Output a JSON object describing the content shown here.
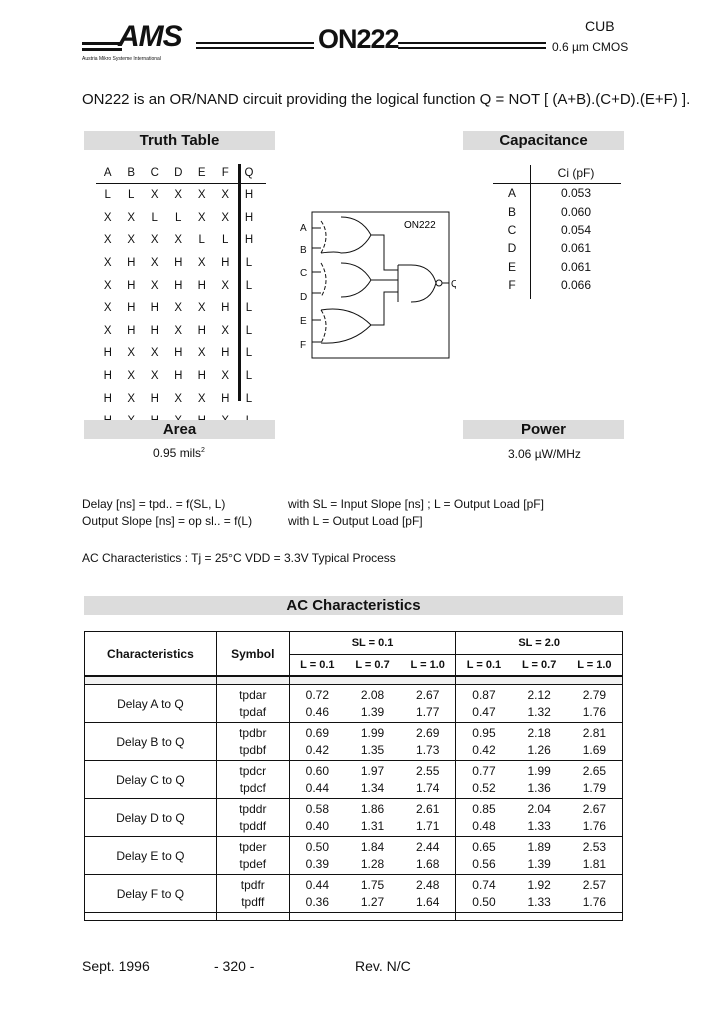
{
  "header": {
    "logo": "AMS",
    "logo_subtitle": "Austria Mikro Systeme International",
    "part": "ON222",
    "process_line1": "CUB",
    "process_line2": "0.6 µm CMOS"
  },
  "description": "ON222 is an OR/NAND circuit providing the logical function Q = NOT [ (A+B).(C+D).(E+F) ].",
  "truth_table": {
    "title": "Truth Table",
    "columns": [
      "A",
      "B",
      "C",
      "D",
      "E",
      "F",
      "Q"
    ],
    "rows": [
      [
        "L",
        "L",
        "X",
        "X",
        "X",
        "X",
        "H"
      ],
      [
        "X",
        "X",
        "L",
        "L",
        "X",
        "X",
        "H"
      ],
      [
        "X",
        "X",
        "X",
        "X",
        "L",
        "L",
        "H"
      ],
      [
        "X",
        "H",
        "X",
        "H",
        "X",
        "H",
        "L"
      ],
      [
        "X",
        "H",
        "X",
        "H",
        "H",
        "X",
        "L"
      ],
      [
        "X",
        "H",
        "H",
        "X",
        "X",
        "H",
        "L"
      ],
      [
        "X",
        "H",
        "H",
        "X",
        "H",
        "X",
        "L"
      ],
      [
        "H",
        "X",
        "X",
        "H",
        "X",
        "H",
        "L"
      ],
      [
        "H",
        "X",
        "X",
        "H",
        "H",
        "X",
        "L"
      ],
      [
        "H",
        "X",
        "H",
        "X",
        "X",
        "H",
        "L"
      ],
      [
        "H",
        "X",
        "H",
        "X",
        "H",
        "X",
        "L"
      ]
    ]
  },
  "schematic": {
    "label": "ON222",
    "inputs": [
      "A",
      "B",
      "C",
      "D",
      "E",
      "F"
    ],
    "output": "Q"
  },
  "capacitance": {
    "title": "Capacitance",
    "header": "Ci (pF)",
    "rows": [
      {
        "pin": "A",
        "value": "0.053"
      },
      {
        "pin": "B",
        "value": "0.060"
      },
      {
        "pin": "C",
        "value": "0.054"
      },
      {
        "pin": "D",
        "value": "0.061"
      },
      {
        "pin": "E",
        "value": "0.061"
      },
      {
        "pin": "F",
        "value": "0.066"
      }
    ]
  },
  "area": {
    "title": "Area",
    "value": "0.95  mils",
    "exp": "2"
  },
  "power": {
    "title": "Power",
    "value": "3.06 µW/MHz"
  },
  "formulas": {
    "delay_left": "Delay [ns]  =  tpd..  =  f(SL, L)",
    "delay_right": "with  SL = Input Slope [ns] ;  L = Output Load [pF]",
    "slope_left": "Output Slope [ns]  =  op  sl..  =  f(L)",
    "slope_right": "with  L = Output Load [pF]",
    "conditions": "AC Characteristics :    Tj = 25°C    VDD = 3.3V    Typical Process"
  },
  "ac": {
    "title": "AC Characteristics",
    "col_char": "Characteristics",
    "col_symbol": "Symbol",
    "groups": [
      "SL = 0.1",
      "SL = 2.0"
    ],
    "loads": [
      "L = 0.1",
      "L = 0.7",
      "L = 1.0",
      "L = 0.1",
      "L = 0.7",
      "L = 1.0"
    ],
    "rows": [
      {
        "name": "Delay A to Q",
        "symbols": [
          "tpdar",
          "tpdaf"
        ],
        "values": [
          [
            "0.72",
            "2.08",
            "2.67",
            "0.87",
            "2.12",
            "2.79"
          ],
          [
            "0.46",
            "1.39",
            "1.77",
            "0.47",
            "1.32",
            "1.76"
          ]
        ]
      },
      {
        "name": "Delay B to Q",
        "symbols": [
          "tpdbr",
          "tpdbf"
        ],
        "values": [
          [
            "0.69",
            "1.99",
            "2.69",
            "0.95",
            "2.18",
            "2.81"
          ],
          [
            "0.42",
            "1.35",
            "1.73",
            "0.42",
            "1.26",
            "1.69"
          ]
        ]
      },
      {
        "name": "Delay C to Q",
        "symbols": [
          "tpdcr",
          "tpdcf"
        ],
        "values": [
          [
            "0.60",
            "1.97",
            "2.55",
            "0.77",
            "1.99",
            "2.65"
          ],
          [
            "0.44",
            "1.34",
            "1.74",
            "0.52",
            "1.36",
            "1.79"
          ]
        ]
      },
      {
        "name": "Delay D to Q",
        "symbols": [
          "tpddr",
          "tpddf"
        ],
        "values": [
          [
            "0.58",
            "1.86",
            "2.61",
            "0.85",
            "2.04",
            "2.67"
          ],
          [
            "0.40",
            "1.31",
            "1.71",
            "0.48",
            "1.33",
            "1.76"
          ]
        ]
      },
      {
        "name": "Delay E to Q",
        "symbols": [
          "tpder",
          "tpdef"
        ],
        "values": [
          [
            "0.50",
            "1.84",
            "2.44",
            "0.65",
            "1.89",
            "2.53"
          ],
          [
            "0.39",
            "1.28",
            "1.68",
            "0.56",
            "1.39",
            "1.81"
          ]
        ]
      },
      {
        "name": "Delay F to Q",
        "symbols": [
          "tpdfr",
          "tpdff"
        ],
        "values": [
          [
            "0.44",
            "1.75",
            "2.48",
            "0.74",
            "1.92",
            "2.57"
          ],
          [
            "0.36",
            "1.27",
            "1.64",
            "0.50",
            "1.33",
            "1.76"
          ]
        ]
      }
    ]
  },
  "footer": {
    "date": "Sept. 1996",
    "page": "- 320 -",
    "rev": "Rev. N/C"
  }
}
